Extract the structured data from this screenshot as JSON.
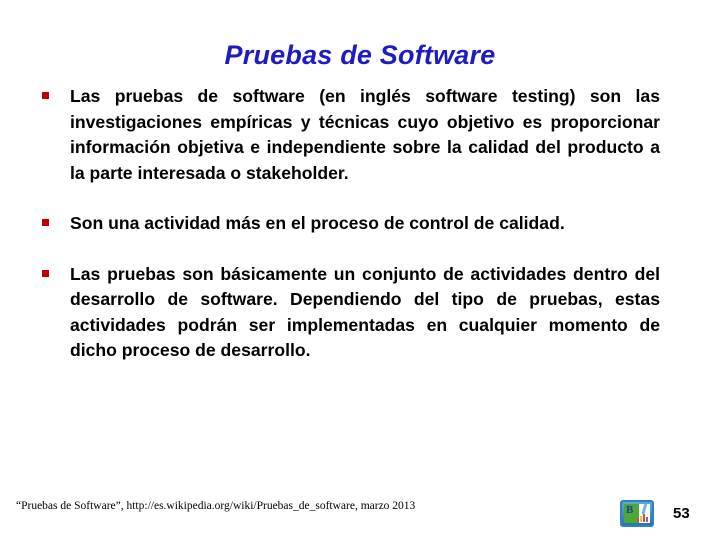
{
  "slide": {
    "title": "Pruebas de Software",
    "title_color": "#1C1CC0",
    "background_color": "#FFFFFF",
    "bullet_color": "#C00000",
    "text_color": "#000000",
    "bullets": [
      {
        "marker": "square-bullet",
        "text": "Las pruebas de software (en inglés software testing) son las investigaciones empíricas y técnicas cuyo objetivo es proporcionar información objetiva e independiente sobre la calidad del producto a la parte interesada o stakeholder."
      },
      {
        "marker": "square-bullet",
        "text": "Son una actividad más en el proceso de control de calidad."
      },
      {
        "marker": "square-bullet",
        "text": "Las pruebas son básicamente un conjunto de actividades dentro del desarrollo de software. Dependiendo del tipo de pruebas, estas actividades podrán ser implementadas en cualquier momento de dicho proceso de desarrollo."
      }
    ]
  },
  "footer": {
    "citation": "“Pruebas de Software”, http://es.wikipedia.org/wiki/Pruebas_de_software, marzo 2013",
    "logo_icon": "picture-placeholder-icon",
    "logo_letter": "B",
    "page_number": "53"
  }
}
